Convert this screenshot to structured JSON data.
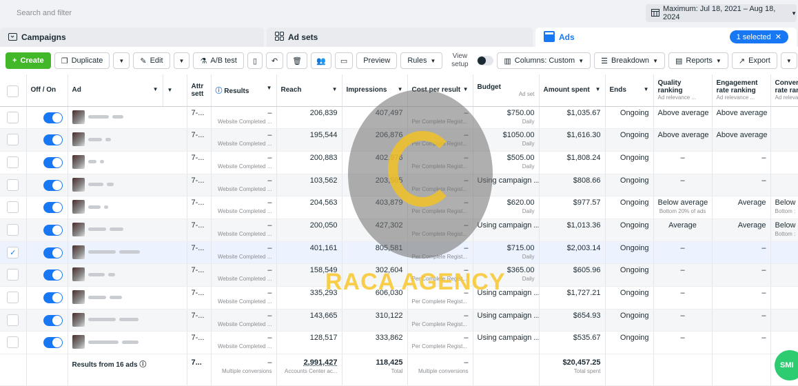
{
  "search": {
    "placeholder": "Search and filter"
  },
  "date_range": {
    "label": "Maximum: Jul 18, 2021 – Aug 18, 2024"
  },
  "tabs": {
    "campaigns": "Campaigns",
    "adsets": "Ad sets",
    "ads": "Ads",
    "selected": "1 selected"
  },
  "toolbar": {
    "create": "Create",
    "duplicate": "Duplicate",
    "edit": "Edit",
    "ab_test": "A/B test",
    "preview": "Preview",
    "rules": "Rules",
    "view_setup_1": "View",
    "view_setup_2": "setup",
    "columns": "Columns: Custom",
    "breakdown": "Breakdown",
    "reports": "Reports",
    "export": "Export"
  },
  "headers": {
    "off_on": "Off / On",
    "ad": "Ad",
    "attr_1": "Attr",
    "attr_2": "sett",
    "results": "Results",
    "reach": "Reach",
    "impressions": "Impressions",
    "cost": "Cost per result",
    "budget": "Budget",
    "budget_sub": "Ad set",
    "amount": "Amount spent",
    "ends": "Ends",
    "quality_1": "Quality",
    "quality_2": "ranking",
    "quality_sub": "Ad relevance ...",
    "engagement_1": "Engagement",
    "engagement_2": "rate ranking",
    "engagement_sub": "Ad relevance ...",
    "conv_1": "Convers",
    "conv_2": "rate rani",
    "conv_sub": "Ad releva"
  },
  "rows": [
    {
      "attr": "7-...",
      "results": "–",
      "results_sub": "Website Completed ...",
      "reach": "206,839",
      "impressions": "407,497",
      "cost": "–",
      "cost_sub": "Per Complete Regist...",
      "budget": "$750.00",
      "budget_sub": "Daily",
      "amount": "$1,035.67",
      "ends": "Ongoing",
      "quality": "Above average",
      "quality_sub": "",
      "engagement": "Above average",
      "conv": "",
      "conv_sub": "",
      "checked": ""
    },
    {
      "attr": "7-...",
      "results": "–",
      "results_sub": "Website Completed ...",
      "reach": "195,544",
      "impressions": "206,876",
      "cost": "–",
      "cost_sub": "Per Complete Regist...",
      "budget": "$1050.00",
      "budget_sub": "Daily",
      "amount": "$1,616.30",
      "ends": "Ongoing",
      "quality": "Above average",
      "quality_sub": "",
      "engagement": "Above average",
      "conv": "",
      "conv_sub": "",
      "checked": ""
    },
    {
      "attr": "7-...",
      "results": "–",
      "results_sub": "Website Completed ...",
      "reach": "200,883",
      "impressions": "402,976",
      "cost": "–",
      "cost_sub": "Per Complete Regist...",
      "budget": "$505.00",
      "budget_sub": "Daily",
      "amount": "$1,808.24",
      "ends": "Ongoing",
      "quality": "–",
      "quality_sub": "",
      "engagement": "–",
      "conv": "",
      "conv_sub": "",
      "checked": ""
    },
    {
      "attr": "7-...",
      "results": "–",
      "results_sub": "Website Completed ...",
      "reach": "103,562",
      "impressions": "203,595",
      "cost": "–",
      "cost_sub": "Per Complete Regist...",
      "budget": "Using campaign ...",
      "budget_sub": "",
      "amount": "$808.66",
      "ends": "Ongoing",
      "quality": "–",
      "quality_sub": "",
      "engagement": "–",
      "conv": "",
      "conv_sub": "",
      "checked": ""
    },
    {
      "attr": "7-...",
      "results": "–",
      "results_sub": "Website Completed ...",
      "reach": "204,563",
      "impressions": "403,879",
      "cost": "–",
      "cost_sub": "Per Complete Regist...",
      "budget": "$620.00",
      "budget_sub": "Daily",
      "amount": "$977.57",
      "ends": "Ongoing",
      "quality": "Below average",
      "quality_sub": "Bottom 20% of ads",
      "engagement": "Average",
      "conv": "Below",
      "conv_sub": "Bottom :",
      "checked": ""
    },
    {
      "attr": "7-...",
      "results": "–",
      "results_sub": "Website Completed ...",
      "reach": "200,050",
      "impressions": "427,302",
      "cost": "–",
      "cost_sub": "Per Complete Regist...",
      "budget": "Using campaign ...",
      "budget_sub": "",
      "amount": "$1,013.36",
      "ends": "Ongoing",
      "quality": "Average",
      "quality_sub": "",
      "engagement": "Average",
      "conv": "Below",
      "conv_sub": "Bottom :",
      "checked": ""
    },
    {
      "attr": "7-...",
      "results": "–",
      "results_sub": "Website Completed ...",
      "reach": "401,161",
      "impressions": "805,581",
      "cost": "–",
      "cost_sub": "Per Complete Regist...",
      "budget": "$715.00",
      "budget_sub": "Daily",
      "amount": "$2,003.14",
      "ends": "Ongoing",
      "quality": "–",
      "quality_sub": "",
      "engagement": "–",
      "conv": "",
      "conv_sub": "",
      "checked": "✓"
    },
    {
      "attr": "7-...",
      "results": "–",
      "results_sub": "Website Completed ...",
      "reach": "158,549",
      "impressions": "302,604",
      "cost": "–",
      "cost_sub": "Per Complete Regist...",
      "budget": "$365.00",
      "budget_sub": "Daily",
      "amount": "$605.96",
      "ends": "Ongoing",
      "quality": "–",
      "quality_sub": "",
      "engagement": "–",
      "conv": "",
      "conv_sub": "",
      "checked": ""
    },
    {
      "attr": "7-...",
      "results": "–",
      "results_sub": "Website Completed ...",
      "reach": "335,293",
      "impressions": "606,030",
      "cost": "–",
      "cost_sub": "Per Complete Regist...",
      "budget": "Using campaign ...",
      "budget_sub": "",
      "amount": "$1,727.21",
      "ends": "Ongoing",
      "quality": "–",
      "quality_sub": "",
      "engagement": "–",
      "conv": "",
      "conv_sub": "",
      "checked": ""
    },
    {
      "attr": "7-...",
      "results": "–",
      "results_sub": "Website Completed ...",
      "reach": "143,665",
      "impressions": "310,122",
      "cost": "–",
      "cost_sub": "Per Complete Regist...",
      "budget": "Using campaign ...",
      "budget_sub": "",
      "amount": "$654.93",
      "ends": "Ongoing",
      "quality": "–",
      "quality_sub": "",
      "engagement": "–",
      "conv": "",
      "conv_sub": "",
      "checked": ""
    },
    {
      "attr": "7-...",
      "results": "–",
      "results_sub": "Website Completed ...",
      "reach": "128,517",
      "impressions": "333,862",
      "cost": "–",
      "cost_sub": "Per Complete Regist...",
      "budget": "Using campaign ...",
      "budget_sub": "",
      "amount": "$535.67",
      "ends": "Ongoing",
      "quality": "–",
      "quality_sub": "",
      "engagement": "–",
      "conv": "",
      "conv_sub": "",
      "checked": ""
    }
  ],
  "totals": {
    "label": "Results from 16 ads",
    "attr": "7...",
    "results": "–",
    "results_sub": "Multiple conversions",
    "reach": "2,991,427",
    "reach_sub": "Accounts Center ac...",
    "impressions": "118,425",
    "impressions_sub": "Total",
    "cost": "–",
    "cost_sub": "Multiple conversions",
    "amount": "$20,457.25",
    "amount_sub": "Total spent"
  },
  "watermark": {
    "text": "RACA AGENCY"
  },
  "chat": {
    "label": "SMI"
  },
  "colors": {
    "accent": "#1877f2",
    "create": "#42b72a",
    "watermark": "#f7c31e"
  }
}
